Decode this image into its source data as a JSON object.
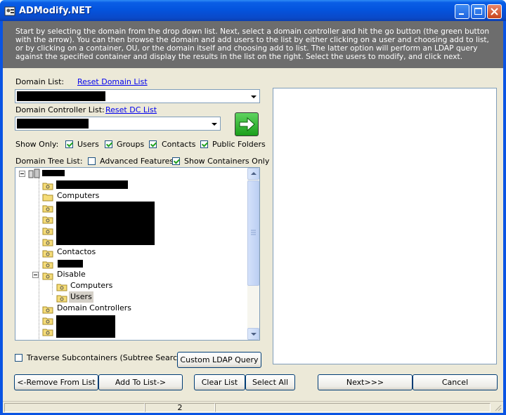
{
  "window": {
    "title": "ADModify.NET"
  },
  "instructions": "Start by selecting the domain from the drop down list.  Next, select a domain controller and hit the go button (the green button with the arrow).  You can then browse the domain and add users to the list by either clicking on a user and choosing add to list, or by clicking on a container, OU, or the domain itself and choosing add to list.  The latter option will perform an LDAP query against the specified container and display the results in the list on the right.  Select the users to modify, and click next.",
  "domain": {
    "label": "Domain List:",
    "reset_link": "Reset Domain List",
    "dc_label": "Domain Controller List:",
    "reset_dc_link": "Reset DC List"
  },
  "show_only": {
    "label": "Show Only:",
    "options": [
      {
        "label": "Users",
        "checked": true
      },
      {
        "label": "Groups",
        "checked": true
      },
      {
        "label": "Contacts",
        "checked": true
      },
      {
        "label": "Public Folders",
        "checked": true
      }
    ]
  },
  "tree_options": {
    "label": "Domain Tree List:",
    "advanced": {
      "label": "Advanced Features",
      "checked": false
    },
    "containers_only": {
      "label": "Show Containers Only",
      "checked": true
    }
  },
  "tree": {
    "items": [
      {
        "label": "Computers"
      },
      {
        "label": "Contactos"
      },
      {
        "label": "Disable"
      },
      {
        "label": "Computers"
      },
      {
        "label": "Users"
      },
      {
        "label": "Domain Controllers"
      }
    ]
  },
  "traverse": {
    "label": "Traverse Subcontainers (Subtree Search)",
    "checked": false
  },
  "buttons": {
    "custom_ldap": "Custom LDAP Query",
    "remove": "<-Remove From List",
    "add": "Add To List->",
    "clear": "Clear List",
    "select_all": "Select All",
    "next": "Next>>>",
    "cancel": "Cancel"
  },
  "status": {
    "count": "2"
  },
  "colors": {
    "titlebar": "#0a54e3",
    "banner": "#6d6d6d",
    "dialog": "#ece9d8",
    "go_button": "#1b9e1b"
  }
}
